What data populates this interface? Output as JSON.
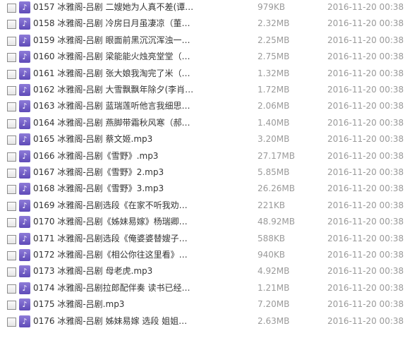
{
  "files": [
    {
      "name": "0157 冰雅阁-吕剧 二嫂她为人真不差(谭…",
      "size": "979KB",
      "date": "2016-11-20 00:38",
      "icon": "music-note-icon"
    },
    {
      "name": "0158 冰雅阁-吕剧 冷房日月虽凄凉（董…",
      "size": "2.32MB",
      "date": "2016-11-20 00:38",
      "icon": "music-note-icon"
    },
    {
      "name": "0159 冰雅阁-吕剧 眼面前黑沉沉浑浊一…",
      "size": "2.25MB",
      "date": "2016-11-20 00:38",
      "icon": "music-note-icon"
    },
    {
      "name": "0160 冰雅阁-吕剧 梁能能火烛亮堂堂（…",
      "size": "2.75MB",
      "date": "2016-11-20 00:38",
      "icon": "music-note-icon"
    },
    {
      "name": "0161 冰雅阁-吕剧 张大娘我淘完了米（…",
      "size": "1.32MB",
      "date": "2016-11-20 00:38",
      "icon": "music-note-icon"
    },
    {
      "name": "0162 冰雅阁-吕剧 大雪飘飘年除夕(李肖…",
      "size": "1.72MB",
      "date": "2016-11-20 00:38",
      "icon": "music-note-icon"
    },
    {
      "name": "0163 冰雅阁-吕剧 蓝瑞莲听他言我细思…",
      "size": "2.06MB",
      "date": "2016-11-20 00:38",
      "icon": "music-note-icon"
    },
    {
      "name": "0164 冰雅阁-吕剧 燕脚带霜秋风寒（郝…",
      "size": "1.40MB",
      "date": "2016-11-20 00:38",
      "icon": "music-note-icon"
    },
    {
      "name": "0165 冰雅阁-吕剧 蔡文姬.mp3",
      "size": "3.20MB",
      "date": "2016-11-20 00:38",
      "icon": "music-note-icon"
    },
    {
      "name": "0166 冰雅阁-吕剧《雪野》.mp3",
      "size": "27.17MB",
      "date": "2016-11-20 00:38",
      "icon": "music-note-icon"
    },
    {
      "name": "0167 冰雅阁-吕剧《雪野》2.mp3",
      "size": "5.85MB",
      "date": "2016-11-20 00:38",
      "icon": "music-note-icon"
    },
    {
      "name": "0168 冰雅阁-吕剧《雪野》3.mp3",
      "size": "26.26MB",
      "date": "2016-11-20 00:38",
      "icon": "music-note-icon"
    },
    {
      "name": "0169 冰雅阁-吕剧选段《在家不听我劝…",
      "size": "221KB",
      "date": "2016-11-20 00:38",
      "icon": "music-note-icon"
    },
    {
      "name": "0170 冰雅阁-吕剧《姊妹易嫁》杨瑞卿…",
      "size": "48.92MB",
      "date": "2016-11-20 00:38",
      "icon": "music-note-icon"
    },
    {
      "name": "0171 冰雅阁-吕剧选段《俺婆婆替嫂子…",
      "size": "588KB",
      "date": "2016-11-20 00:38",
      "icon": "music-note-icon"
    },
    {
      "name": "0172 冰雅阁-吕剧《相公你往这里看》…",
      "size": "940KB",
      "date": "2016-11-20 00:38",
      "icon": "music-note-icon"
    },
    {
      "name": "0173 冰雅阁-吕剧 母老虎.mp3",
      "size": "4.92MB",
      "date": "2016-11-20 00:38",
      "icon": "music-note-icon"
    },
    {
      "name": "0174 冰雅阁-吕剧拉郎配伴奏 读书已经…",
      "size": "1.21MB",
      "date": "2016-11-20 00:38",
      "icon": "music-note-icon"
    },
    {
      "name": "0175 冰雅阁-吕剧.mp3",
      "size": "7.20MB",
      "date": "2016-11-20 00:38",
      "icon": "music-note-icon"
    },
    {
      "name": "0176 冰雅阁-吕剧 姊妹易嫁 选段 姐姐…",
      "size": "2.63MB",
      "date": "2016-11-20 00:38",
      "icon": "music-note-icon"
    }
  ]
}
